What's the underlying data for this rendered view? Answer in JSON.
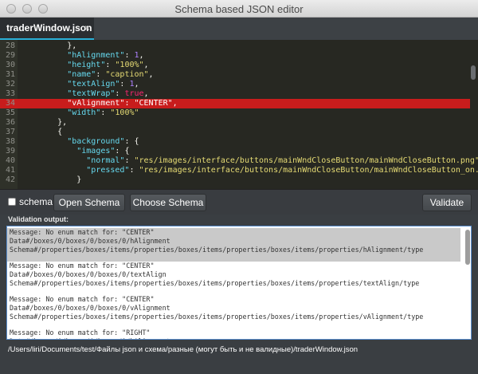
{
  "window": {
    "title": "Schema based JSON editor"
  },
  "tabs": [
    {
      "label": "traderWindow.json",
      "close": "×"
    }
  ],
  "editor": {
    "lines": [
      {
        "num": "28",
        "indent": 10,
        "tokens": [
          {
            "t": "p",
            "v": "},"
          }
        ]
      },
      {
        "num": "29",
        "indent": 10,
        "tokens": [
          {
            "t": "k",
            "v": "\"hAlignment\""
          },
          {
            "t": "p",
            "v": ": "
          },
          {
            "t": "n",
            "v": "1"
          },
          {
            "t": "p",
            "v": ","
          }
        ]
      },
      {
        "num": "30",
        "indent": 10,
        "tokens": [
          {
            "t": "k",
            "v": "\"height\""
          },
          {
            "t": "p",
            "v": ": "
          },
          {
            "t": "s",
            "v": "\"100%\""
          },
          {
            "t": "p",
            "v": ","
          }
        ]
      },
      {
        "num": "31",
        "indent": 10,
        "tokens": [
          {
            "t": "k",
            "v": "\"name\""
          },
          {
            "t": "p",
            "v": ": "
          },
          {
            "t": "s",
            "v": "\"caption\""
          },
          {
            "t": "p",
            "v": ","
          }
        ]
      },
      {
        "num": "32",
        "indent": 10,
        "tokens": [
          {
            "t": "k",
            "v": "\"textAlign\""
          },
          {
            "t": "p",
            "v": ": "
          },
          {
            "t": "n",
            "v": "1"
          },
          {
            "t": "p",
            "v": ","
          }
        ]
      },
      {
        "num": "33",
        "indent": 10,
        "tokens": [
          {
            "t": "k",
            "v": "\"textWrap\""
          },
          {
            "t": "p",
            "v": ": "
          },
          {
            "t": "b",
            "v": "true"
          },
          {
            "t": "p",
            "v": ","
          }
        ]
      },
      {
        "num": "34",
        "indent": 10,
        "highlight": true,
        "tokens": [
          {
            "t": "k",
            "v": "\"vAlignment\""
          },
          {
            "t": "p",
            "v": ": "
          },
          {
            "t": "s",
            "v": "\"CENTER\""
          },
          {
            "t": "p",
            "v": ","
          }
        ]
      },
      {
        "num": "35",
        "indent": 10,
        "tokens": [
          {
            "t": "k",
            "v": "\"width\""
          },
          {
            "t": "p",
            "v": ": "
          },
          {
            "t": "s",
            "v": "\"100%\""
          }
        ]
      },
      {
        "num": "36",
        "indent": 8,
        "tokens": [
          {
            "t": "p",
            "v": "},"
          }
        ]
      },
      {
        "num": "37",
        "indent": 8,
        "tokens": [
          {
            "t": "p",
            "v": "{"
          }
        ]
      },
      {
        "num": "38",
        "indent": 10,
        "tokens": [
          {
            "t": "k",
            "v": "\"background\""
          },
          {
            "t": "p",
            "v": ": {"
          }
        ]
      },
      {
        "num": "39",
        "indent": 12,
        "tokens": [
          {
            "t": "k",
            "v": "\"images\""
          },
          {
            "t": "p",
            "v": ": {"
          }
        ]
      },
      {
        "num": "40",
        "indent": 14,
        "tokens": [
          {
            "t": "k",
            "v": "\"normal\""
          },
          {
            "t": "p",
            "v": ": "
          },
          {
            "t": "s",
            "v": "\"res/images/interface/buttons/mainWndCloseButton/mainWndCloseButton.png\""
          },
          {
            "t": "p",
            "v": ","
          }
        ]
      },
      {
        "num": "41",
        "indent": 14,
        "tokens": [
          {
            "t": "k",
            "v": "\"pressed\""
          },
          {
            "t": "p",
            "v": ": "
          },
          {
            "t": "s",
            "v": "\"res/images/interface/buttons/mainWndCloseButton/mainWndCloseButton_on.png\""
          }
        ]
      },
      {
        "num": "42",
        "indent": 12,
        "tokens": [
          {
            "t": "p",
            "v": "}"
          }
        ]
      }
    ]
  },
  "toolbar": {
    "schema_checkbox_label": "schema",
    "open_schema": "Open Schema",
    "choose_schema": "Choose Schema",
    "validate": "Validate"
  },
  "validation": {
    "label": "Validation output:",
    "messages": [
      {
        "selected": true,
        "lines": [
          "Message: No enum match for: \"CENTER\"",
          "Data#/boxes/0/boxes/0/boxes/0/hAlignment",
          "Schema#/properties/boxes/items/properties/boxes/items/properties/boxes/items/properties/hAlignment/type"
        ]
      },
      {
        "selected": false,
        "lines": [
          "Message: No enum match for: \"CENTER\"",
          "Data#/boxes/0/boxes/0/boxes/0/textAlign",
          "Schema#/properties/boxes/items/properties/boxes/items/properties/boxes/items/properties/textAlign/type"
        ]
      },
      {
        "selected": false,
        "lines": [
          "Message: No enum match for: \"CENTER\"",
          "Data#/boxes/0/boxes/0/boxes/0/vAlignment",
          "Schema#/properties/boxes/items/properties/boxes/items/properties/boxes/items/properties/vAlignment/type"
        ]
      },
      {
        "selected": false,
        "lines": [
          "Message: No enum match for: \"RIGHT\"",
          "Data#/boxes/0/boxes/0/boxes/1/hAlignment",
          ""
        ]
      }
    ]
  },
  "status": {
    "path": "/Users/liri/Documents/test/Файлы  json и схема/разные (могут быть и не валидные)/traderWindow.json"
  },
  "colors": {
    "accent": "#2ab0d8",
    "error_highlight": "#c81c1c",
    "editor_bg": "#272822",
    "key": "#66d9ef",
    "string": "#e6db74",
    "number": "#ae81ff",
    "boolean": "#f92672"
  }
}
